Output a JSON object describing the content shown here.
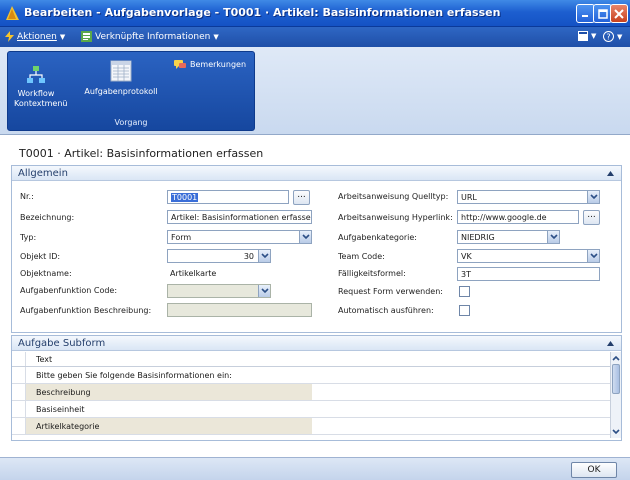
{
  "window": {
    "title": "Bearbeiten - Aufgabenvorlage - T0001 · Artikel: Basisinformationen erfassen"
  },
  "menubar": {
    "aktionen": "Aktionen",
    "verknuepfte": "Verknüpfte Informationen"
  },
  "ribbon": {
    "workflow_line1": "Workflow",
    "workflow_line2": "Kontextmenü",
    "aufgabenprotokoll": "Aufgabenprotokoll",
    "bemerkungen": "Bemerkungen",
    "group_label": "Vorgang"
  },
  "page": {
    "title": "T0001 · Artikel: Basisinformationen erfassen"
  },
  "allgemein": {
    "header": "Allgemein",
    "left": {
      "nr_label": "Nr.:",
      "nr_value": "T0001",
      "bezeichnung_label": "Bezeichnung:",
      "bezeichnung_value": "Artikel: Basisinformationen erfassen",
      "typ_label": "Typ:",
      "typ_value": "Form",
      "objekt_id_label": "Objekt ID:",
      "objekt_id_value": "30",
      "objektname_label": "Objektname:",
      "objektname_value": "Artikelkarte",
      "aufgabenfunktion_code_label": "Aufgabenfunktion Code:",
      "aufgabenfunktion_code_value": "",
      "aufgabenfunktion_beschreibung_label": "Aufgabenfunktion Beschreibung:",
      "aufgabenfunktion_beschreibung_value": ""
    },
    "right": {
      "quelltyp_label": "Arbeitsanweisung Quelltyp:",
      "quelltyp_value": "URL",
      "hyperlink_label": "Arbeitsanweisung Hyperlink:",
      "hyperlink_value": "http://www.google.de",
      "kategorie_label": "Aufgabenkategorie:",
      "kategorie_value": "NIEDRIG",
      "team_code_label": "Team Code:",
      "team_code_value": "VK",
      "faelligkeit_label": "Fälligkeitsformel:",
      "faelligkeit_value": "3T",
      "request_form_label": "Request Form verwenden:",
      "auto_label": "Automatisch ausführen:"
    }
  },
  "subform": {
    "header": "Aufgabe Subform",
    "column": "Text",
    "rows": [
      "Bitte geben Sie folgende Basisinformationen ein:",
      "Beschreibung",
      "Basiseinheit",
      "Artikelkategorie"
    ]
  },
  "footer": {
    "ok": "OK"
  }
}
